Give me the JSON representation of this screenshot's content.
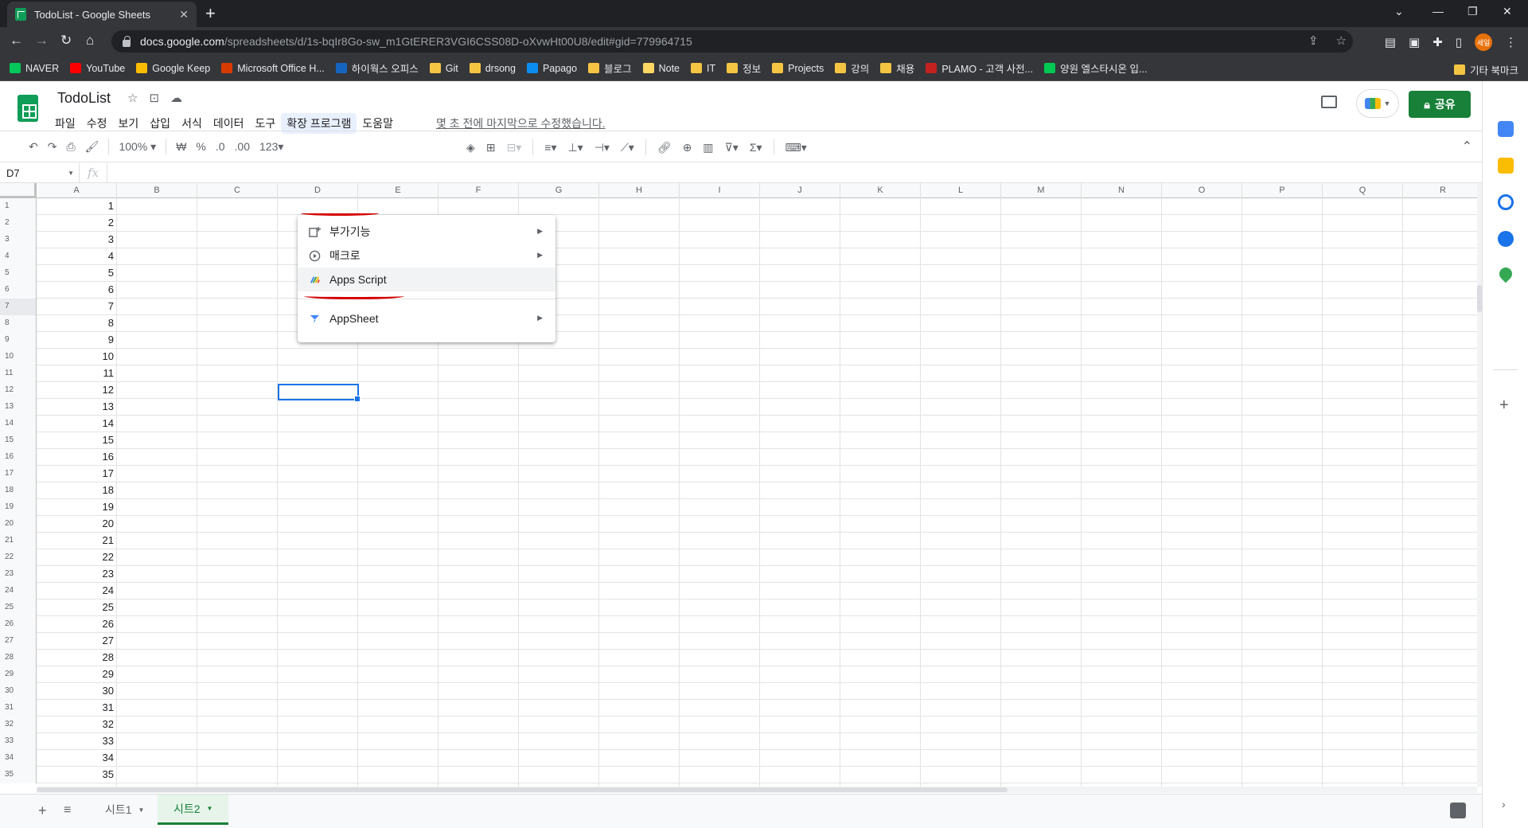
{
  "browser": {
    "tab_title": "TodoList - Google Sheets",
    "url_host": "docs.google.com",
    "url_path": "/spreadsheets/d/1s-bqIr8Go-sw_m1GtERER3VGI6CSS08D-oXvwHt00U8/edit#gid=779964715",
    "profile_label": "세일",
    "bookmarks": [
      "NAVER",
      "YouTube",
      "Google Keep",
      "Microsoft Office H...",
      "하이웍스 오피스",
      "Git",
      "drsong",
      "Papago",
      "블로그",
      "Note",
      "IT",
      "정보",
      "Projects",
      "강의",
      "채용",
      "PLAMO - 고객 사전...",
      "양원 엘스타시온 입..."
    ],
    "other_bookmarks": "기타 북마크"
  },
  "doc": {
    "title": "TodoList",
    "menus": [
      "파일",
      "수정",
      "보기",
      "삽입",
      "서식",
      "데이터",
      "도구",
      "확장 프로그램",
      "도움말"
    ],
    "last_edit": "몇 초 전에 마지막으로 수정했습니다.",
    "share_label": "공유",
    "avatar_label": "세일"
  },
  "toolbar": {
    "zoom": "100%",
    "currency": "₩",
    "percent": "%",
    "dec_less": ".0",
    "dec_more": ".00",
    "format_more": "123"
  },
  "formula_bar": {
    "name_box": "D7",
    "fx": "fx"
  },
  "grid": {
    "columns": [
      "A",
      "B",
      "C",
      "D",
      "E",
      "F",
      "G",
      "H",
      "I",
      "J",
      "K",
      "L",
      "M",
      "N",
      "O",
      "P",
      "Q",
      "R"
    ],
    "rows": [
      1,
      2,
      3,
      4,
      5,
      6,
      7,
      8,
      9,
      10,
      11,
      12,
      13,
      14,
      15,
      16,
      17,
      18,
      19,
      20,
      21,
      22,
      23,
      24,
      25,
      26,
      27,
      28,
      29,
      30,
      31,
      32,
      33,
      34,
      35
    ],
    "col_a_values": [
      1,
      2,
      3,
      4,
      5,
      6,
      7,
      8,
      9,
      10,
      11,
      12,
      13,
      14,
      15,
      16,
      17,
      18,
      19,
      20,
      21,
      22,
      23,
      24,
      25,
      26,
      27,
      28,
      29,
      30,
      31,
      32,
      33,
      34,
      35
    ],
    "selected_cell": "D7"
  },
  "sheets": {
    "tabs": [
      "시트1",
      "시트2"
    ],
    "active": "시트2"
  },
  "dropdown": {
    "items": [
      {
        "label": "부가기능",
        "submenu": true,
        "icon": "addon-icon"
      },
      {
        "label": "매크로",
        "submenu": true,
        "icon": "macro-play-icon"
      },
      {
        "label": "Apps Script",
        "submenu": false,
        "icon": "apps-script-icon"
      },
      {
        "label": "AppSheet",
        "submenu": true,
        "icon": "appsheet-icon"
      }
    ]
  },
  "colors": {
    "accent_green": "#188038",
    "selection_blue": "#1a73e8",
    "annotation_red": "#d50000",
    "avatar_orange": "#e8710a"
  }
}
